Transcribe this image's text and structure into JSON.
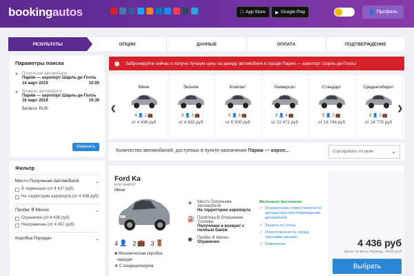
{
  "header": {
    "logo_part1": "booking",
    "logo_part2": "autos",
    "socials": [
      {
        "icon": "bookmark-icon",
        "color": "#d22"
      },
      {
        "icon": "vk-icon",
        "color": "#4a76a8"
      },
      {
        "icon": "facebook-icon",
        "color": "#3b5998"
      },
      {
        "icon": "twitter-icon",
        "color": "#1da1f2"
      },
      {
        "icon": "odnoklassniki-icon",
        "color": "#f58220"
      },
      {
        "icon": "linkedin-icon",
        "color": "#0077b5"
      },
      {
        "icon": "mail-icon",
        "color": "#168de2"
      },
      {
        "icon": "pocket-icon",
        "color": "#ef3f56"
      },
      {
        "icon": "tumblr-icon",
        "color": "#35465c"
      },
      {
        "icon": "telegram-icon",
        "color": "#2ca5e0"
      }
    ],
    "app_store": "App Store",
    "google_play": "Google Play",
    "profile": "Профиль"
  },
  "steps": [
    "РЕЗУЛЬТАТЫ",
    "ОПЦИИ",
    "ДАННЫЕ",
    "ОПЛАТА",
    "ПОДТВЕРЖДЕНИЕ"
  ],
  "search": {
    "title": "Параметры поиска",
    "pickup_label": "Получение автомобиля",
    "pickup_place": "Париж — аэропорт Шарль-де-Голль",
    "pickup_date": "14 март 2019",
    "pickup_time": "10:00",
    "return_label": "Возврат автомобиля",
    "return_place": "Париж — аэропорт Шарль-де-Голль",
    "return_date": "16 март 2019",
    "return_time": "10:30",
    "currency": "Валюта: RUB",
    "change": "Изменить"
  },
  "filter": {
    "title": "Фильтр",
    "pickup_section": "Место Получения Автомобиля",
    "opt_terminal": "В терминале (от 4 437 руб)",
    "opt_outside": "Не территории аэропорта (от 4 436 руб)",
    "mileage_section": "Пробег В Милях",
    "opt_limited": "Ограничен (от 4 436 руб)",
    "opt_unlimited": "Неограничен (от 4 457 руб)",
    "gearbox_section": "Коробка Передач"
  },
  "alert": "Забронируйте сейчас и получи лучшую цену на аренду автомобиля в городе Париж — аэропорт Шарль-де-Голль!",
  "categories": [
    {
      "name": "Мини",
      "seats": "4",
      "bags": "2",
      "price": "от 4 436 руб"
    },
    {
      "name": "Эконом",
      "seats": "5",
      "bags": "2",
      "price": "от 4 892 руб"
    },
    {
      "name": "Компакт",
      "seats": "5",
      "bags": "3",
      "price": "от 6 500 руб"
    },
    {
      "name": "Универсал",
      "seats": "5",
      "bags": "4",
      "price": "от 22 471 руб"
    },
    {
      "name": "Стандарт",
      "seats": "5",
      "bags": "2",
      "price": "от 16 746 руб"
    },
    {
      "name": "Среднегабарит",
      "seats": "5",
      "bags": "3",
      "price": "от 24 770 руб"
    }
  ],
  "results": {
    "count_text_prefix": "Количество автомобилей, доступных в пункте назначения ",
    "count_text_place": "Париж — аэроп...",
    "sort": "Сортировать по цене"
  },
  "offer": {
    "name": "Ford Ka",
    "similar": "или аналог",
    "class": "Мини",
    "seats": "4",
    "bags": "2",
    "doors": "3",
    "feature1": "Механическая коробка",
    "feature1b": "передач",
    "feature2": "С кондиционером",
    "location_label": "Место Получения",
    "location_label2": "Автомобиля",
    "location_value": "На территории аэропорта",
    "fuel_label": "Политика В Отношении",
    "fuel_label2": "Топлива",
    "fuel_value": "Получение и возврат с полным баком",
    "mileage_label": "Пробег В Милях",
    "mileage_value": "Ограничен",
    "included_title": "Включено бесплатно",
    "included": [
      "Ограничение ответственности арендатора при повреждении автомобиля",
      "Защита от угона",
      "Ответственность перед третьими лицами",
      "Изменения"
    ],
    "price": "4 436 руб",
    "price_note": "Цена за весь период, 4436 руб",
    "select": "Выбрать"
  }
}
